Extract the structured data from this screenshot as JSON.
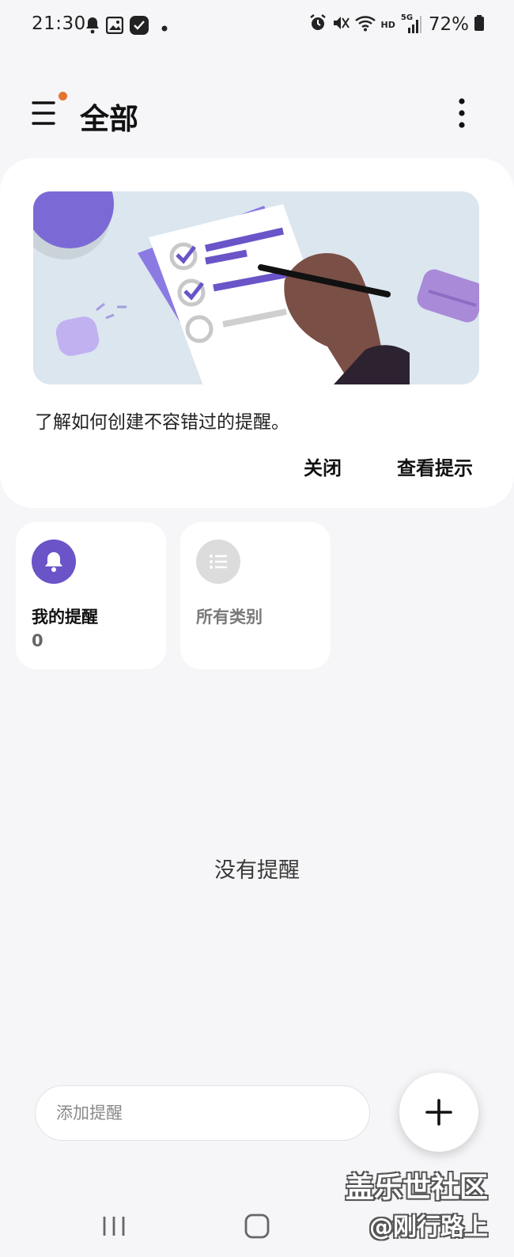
{
  "status_bar": {
    "time": "21:30",
    "left_icons": [
      "bell-icon",
      "gallery-icon",
      "reminder-app-icon",
      "dot-icon"
    ],
    "right_icons": [
      "alarm-icon",
      "mute-icon",
      "wifi-icon",
      "hd-icon",
      "signal-5g-icon",
      "battery-icon"
    ],
    "hd_label": "HD",
    "network_label": "5G",
    "battery": "72%"
  },
  "header": {
    "title": "全部",
    "menu_icon": "hamburger-menu-icon",
    "more_icon": "more-vertical-icon",
    "notification_dot_color": "#e5742e"
  },
  "tip_card": {
    "text": "了解如何创建不容错过的提醒。",
    "close_label": "关闭",
    "view_label": "查看提示",
    "illustration": "checklist-with-hand-holding-pen"
  },
  "categories": [
    {
      "title": "我的提醒",
      "count": "0",
      "icon": "bell-icon",
      "icon_bg": "#6a54c8"
    },
    {
      "title": "所有类别",
      "icon": "list-icon",
      "icon_bg": "#dcdcdc"
    }
  ],
  "empty_state": {
    "text": "没有提醒"
  },
  "bottom": {
    "add_placeholder": "添加提醒",
    "fab_icon": "plus-icon"
  },
  "watermark": {
    "line1": "盖乐世社区",
    "line2": "@刚行路上"
  },
  "nav_bar": {
    "icons": [
      "recent-apps-icon",
      "home-icon",
      "back-icon"
    ]
  },
  "colors": {
    "accent": "#6a54c8",
    "background": "#f6f6f8",
    "card": "#ffffff"
  }
}
